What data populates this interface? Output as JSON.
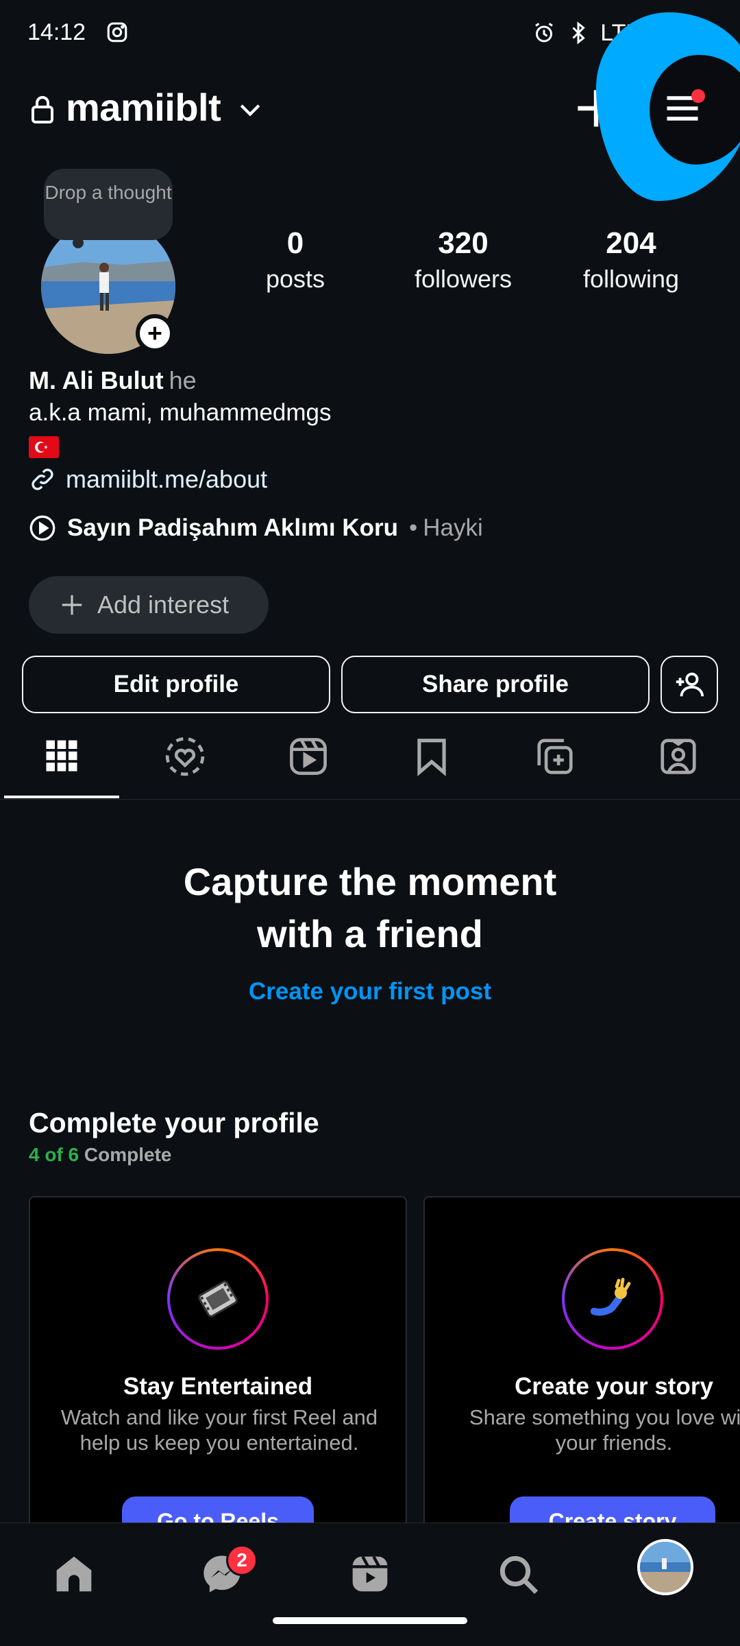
{
  "status_bar": {
    "time": "14:12",
    "network": "LTE⁺"
  },
  "header": {
    "username": "mamiiblt"
  },
  "profile": {
    "thought_bubble": "Drop a thought",
    "stats": [
      {
        "number": "0",
        "label": "posts"
      },
      {
        "number": "320",
        "label": "followers"
      },
      {
        "number": "204",
        "label": "following"
      }
    ],
    "full_name": "M. Ali Bulut",
    "pronoun": "he",
    "bio": "a.k.a mami, muhammedmgs",
    "flag": "🇹🇷",
    "link": "mamiiblt.me/about",
    "music": {
      "song": "Sayın Padişahım Aklımı Koru",
      "separator": "•",
      "artist": "Hayki"
    },
    "add_interest": "Add interest"
  },
  "buttons": {
    "edit": "Edit profile",
    "share": "Share profile"
  },
  "tabs": [
    "grid-icon",
    "heart-circle-icon",
    "reels-icon",
    "bookmark-icon",
    "collab-icon",
    "tagged-icon"
  ],
  "empty_state": {
    "title_line1": "Capture the moment",
    "title_line2": "with a friend",
    "cta": "Create your first post"
  },
  "complete_profile": {
    "title": "Complete your profile",
    "progress_count": "4 of 6",
    "progress_label": "Complete",
    "cards": [
      {
        "icon": "film-icon",
        "title": "Stay Entertained",
        "desc": "Watch and like your first Reel and help us keep you entertained.",
        "button": "Go to Reels"
      },
      {
        "icon": "hand-icon",
        "title": "Create your story",
        "desc": "Share something you love with your friends.",
        "button": "Create story"
      }
    ]
  },
  "bottom_nav": {
    "messages_badge": "2"
  },
  "colors": {
    "background": "#0c1014",
    "accent": "#0095f6",
    "button_blue": "#4a5df9",
    "annotation": "#00aaff",
    "badge": "#ff3040",
    "progress_green": "#2cb14a"
  }
}
